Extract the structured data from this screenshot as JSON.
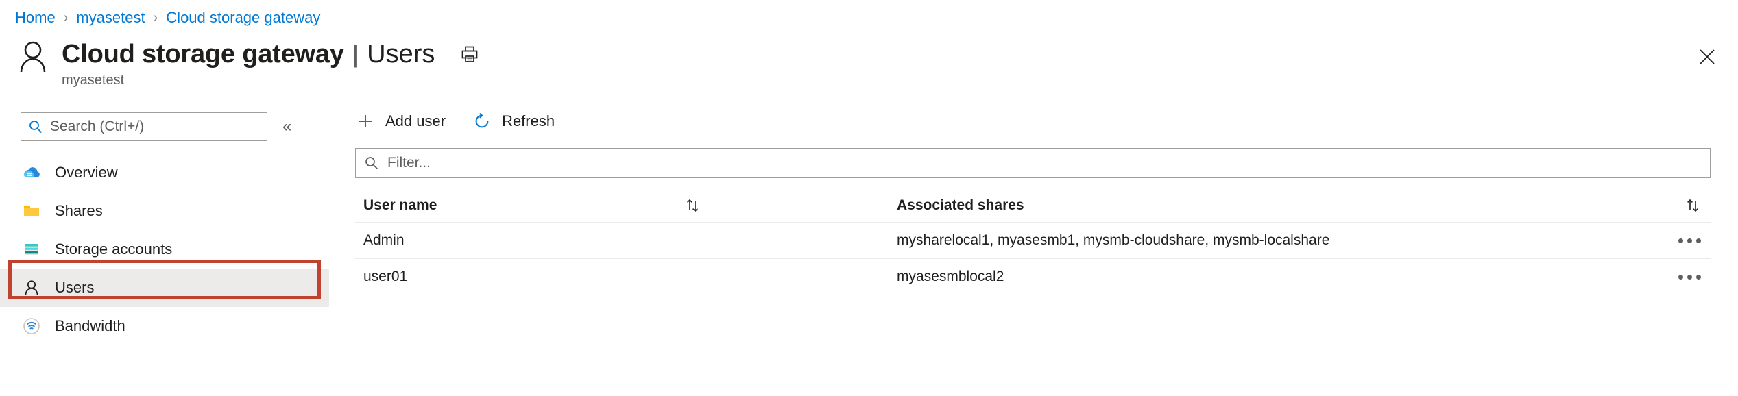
{
  "breadcrumb": {
    "items": [
      {
        "label": "Home"
      },
      {
        "label": "myasetest"
      },
      {
        "label": "Cloud storage gateway"
      }
    ],
    "separator": "›"
  },
  "header": {
    "title": "Cloud storage gateway",
    "separator": "|",
    "page": "Users",
    "subtitle": "myasetest",
    "print_icon": "print-icon",
    "close_icon": "close-icon",
    "resource_icon": "user-outline-icon"
  },
  "sidebar": {
    "search": {
      "placeholder": "Search (Ctrl+/)",
      "icon": "search-icon"
    },
    "collapse_label": "«",
    "items": [
      {
        "label": "Overview",
        "icon": "cloud-icon",
        "selected": false
      },
      {
        "label": "Shares",
        "icon": "folder-icon",
        "selected": false
      },
      {
        "label": "Storage accounts",
        "icon": "storage-account-icon",
        "selected": false
      },
      {
        "label": "Users",
        "icon": "user-icon",
        "selected": true
      },
      {
        "label": "Bandwidth",
        "icon": "bandwidth-icon",
        "selected": false
      }
    ]
  },
  "toolbar": {
    "add_user_label": "Add user",
    "add_user_icon": "plus-icon",
    "refresh_label": "Refresh",
    "refresh_icon": "refresh-icon"
  },
  "filter": {
    "placeholder": "Filter...",
    "icon": "search-icon"
  },
  "table": {
    "columns": [
      {
        "label": "User name",
        "sort_icon": "sort-icon"
      },
      {
        "label": "Associated shares",
        "sort_icon": "sort-icon"
      }
    ],
    "rows": [
      {
        "user_name": "Admin",
        "associated_shares": "mysharelocal1, myasesmb1, mysmb-cloudshare, mysmb-localshare",
        "menu_icon": "ellipsis-icon"
      },
      {
        "user_name": "user01",
        "associated_shares": "myasesmblocal2",
        "menu_icon": "ellipsis-icon"
      }
    ]
  },
  "colors": {
    "link": "#0078d4",
    "annotation": "#c0432f",
    "selected_row": "#edebe9",
    "folder": "#ffb900",
    "text": "#201f1e",
    "muted": "#605e5c"
  }
}
